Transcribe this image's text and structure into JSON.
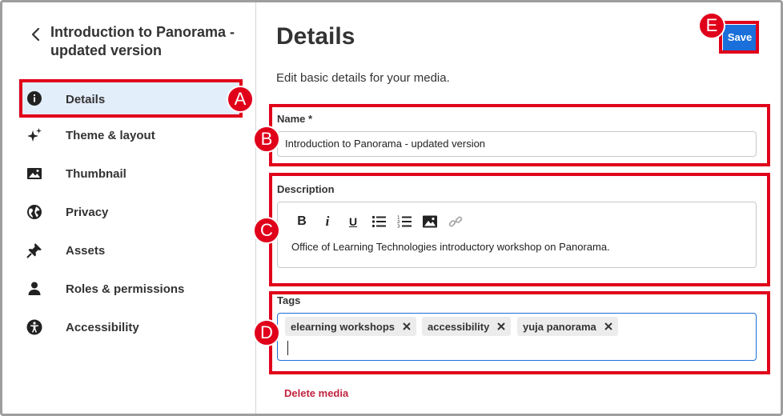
{
  "sidebar": {
    "back_icon": "chevron-left-icon",
    "title": "Introduction to Panorama - updated version",
    "items": [
      {
        "label": "Details",
        "icon": "info-icon",
        "active": true
      },
      {
        "label": "Theme & layout",
        "icon": "sparkle-icon"
      },
      {
        "label": "Thumbnail",
        "icon": "image-icon"
      },
      {
        "label": "Privacy",
        "icon": "globe-icon"
      },
      {
        "label": "Assets",
        "icon": "pin-icon"
      },
      {
        "label": "Roles & permissions",
        "icon": "person-icon"
      },
      {
        "label": "Accessibility",
        "icon": "accessibility-icon"
      }
    ]
  },
  "main": {
    "title": "Details",
    "subtitle": "Edit basic details for your media.",
    "save_label": "Save",
    "name": {
      "label": "Name *",
      "value": "Introduction to Panorama - updated version"
    },
    "description": {
      "label": "Description",
      "toolbar": [
        "bold-icon",
        "italic-icon",
        "underline-icon",
        "bullet-list-icon",
        "numbered-list-icon",
        "insert-image-icon",
        "link-icon"
      ],
      "bold_glyph": "B",
      "italic_glyph": "i",
      "underline_glyph": "U",
      "value": "Office of Learning Technologies introductory workshop on Panorama."
    },
    "tags": {
      "label": "Tags",
      "items": [
        "elearning workshops",
        "accessibility",
        "yuja panorama"
      ]
    },
    "delete_label": "Delete media"
  },
  "annotations": [
    "A",
    "B",
    "C",
    "D",
    "E"
  ],
  "colors": {
    "accent": "#1a6fdb",
    "annotation": "#e0001a",
    "active_bg": "#e3eefb",
    "danger": "#c0243f"
  }
}
